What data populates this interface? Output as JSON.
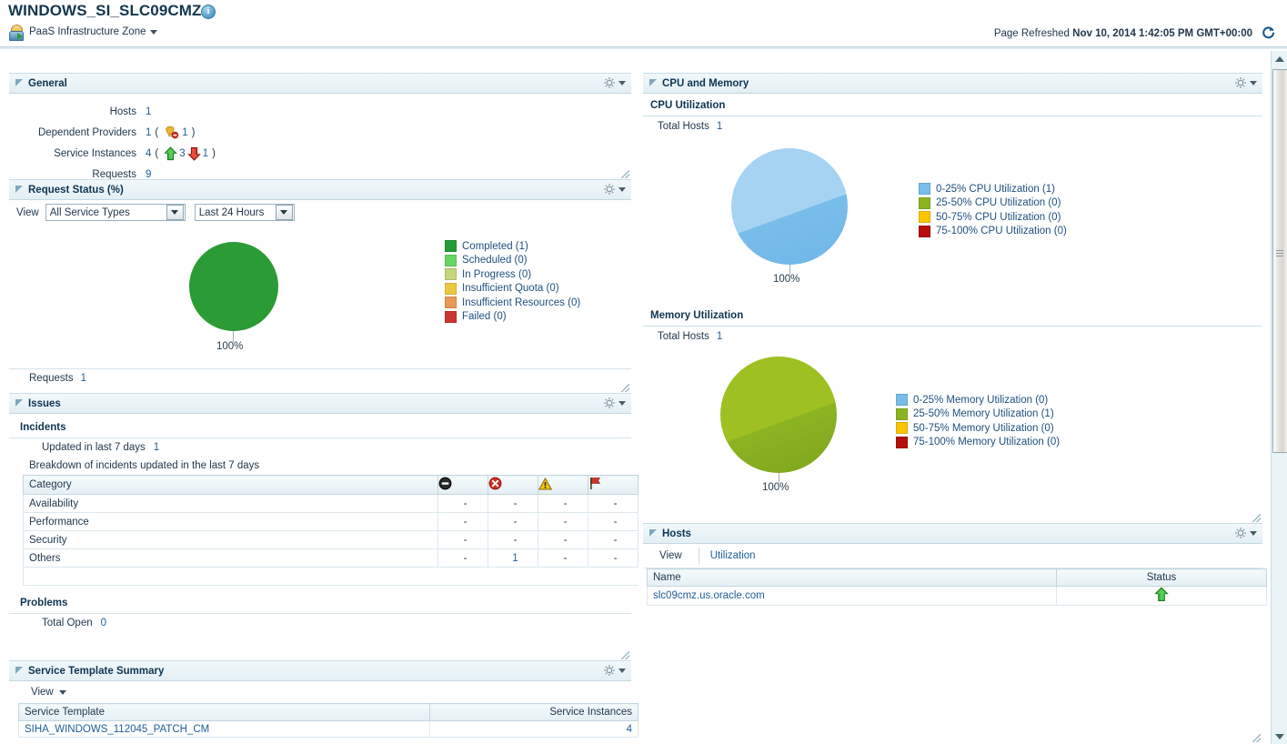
{
  "header": {
    "title": "WINDOWS_SI_SLC09CMZ",
    "info_icon": "info-icon",
    "zone_label": "PaaS Infrastructure Zone",
    "refresh_prefix": "Page Refreshed",
    "refresh_time": "Nov 10, 2014 1:42:05 PM GMT+00:00",
    "refresh_icon": "refresh-icon"
  },
  "general": {
    "panel_title": "General",
    "rows": [
      {
        "label": "Hosts",
        "value": "1"
      },
      {
        "label": "Dependent Providers",
        "value": "1",
        "paren_open": "(",
        "icon": "provider-error-icon",
        "icon_count": "1",
        "paren_close": ")"
      },
      {
        "label": "Service Instances",
        "value": "4",
        "paren_open": "(",
        "up_count": "3",
        "down_count": "1",
        "paren_close": ")"
      },
      {
        "label": "Requests",
        "value": "9"
      }
    ]
  },
  "request_status": {
    "panel_title": "Request Status (%)",
    "view_label": "View",
    "service_type_value": "All Service Types",
    "period_value": "Last 24 Hours",
    "pie_label": "100%",
    "footer_label": "Requests",
    "footer_value": "1",
    "legend": [
      {
        "label": "Completed (1)",
        "color": "#259b35"
      },
      {
        "label": "Scheduled (0)",
        "color": "#68d662"
      },
      {
        "label": "In Progress (0)",
        "color": "#c6d77b"
      },
      {
        "label": "Insufficient Quota (0)",
        "color": "#ebc840"
      },
      {
        "label": "Insufficient Resources (0)",
        "color": "#e89a55"
      },
      {
        "label": "Failed (0)",
        "color": "#cc3530"
      }
    ]
  },
  "issues": {
    "panel_title": "Issues",
    "incidents_title": "Incidents",
    "updated_label": "Updated in last 7 days",
    "updated_value": "1",
    "breakdown_note": "Breakdown of incidents updated in the last 7 days",
    "columns": [
      "Category",
      "fatal-icon",
      "critical-icon",
      "warning-icon",
      "flag-icon"
    ],
    "rows": [
      {
        "category": "Availability",
        "fatal": "-",
        "critical": "-",
        "warning": "-",
        "flag": "-"
      },
      {
        "category": "Performance",
        "fatal": "-",
        "critical": "-",
        "warning": "-",
        "flag": "-"
      },
      {
        "category": "Security",
        "fatal": "-",
        "critical": "-",
        "warning": "-",
        "flag": "-"
      },
      {
        "category": "Others",
        "fatal": "-",
        "critical": "1",
        "warning": "-",
        "flag": "-"
      }
    ],
    "problems_title": "Problems",
    "total_open_label": "Total Open",
    "total_open_value": "0"
  },
  "service_template_summary": {
    "panel_title": "Service Template Summary",
    "view_label": "View",
    "columns": [
      "Service Template",
      "Service Instances"
    ],
    "rows": [
      {
        "template": "SIHA_WINDOWS_112045_PATCH_CM",
        "instances": "4"
      }
    ]
  },
  "cpu_memory": {
    "panel_title": "CPU and Memory",
    "cpu_title": "CPU Utilization",
    "cpu_total_hosts_label": "Total Hosts",
    "cpu_total_hosts_value": "1",
    "cpu_pie_label": "100%",
    "cpu_legend": [
      {
        "label": "0-25% CPU Utilization (1)",
        "color": "#79bdea"
      },
      {
        "label": "25-50% CPU Utilization (0)",
        "color": "#8cb422"
      },
      {
        "label": "50-75% CPU Utilization (0)",
        "color": "#fbc400"
      },
      {
        "label": "75-100% CPU Utilization (0)",
        "color": "#b50d0d"
      }
    ],
    "mem_title": "Memory Utilization",
    "mem_total_hosts_label": "Total Hosts",
    "mem_total_hosts_value": "1",
    "mem_pie_label": "100%",
    "mem_legend": [
      {
        "label": "0-25% Memory Utilization (0)",
        "color": "#79bdea"
      },
      {
        "label": "25-50% Memory Utilization (1)",
        "color": "#8cb422"
      },
      {
        "label": "50-75% Memory Utilization (0)",
        "color": "#fbc400"
      },
      {
        "label": "75-100% Memory Utilization (0)",
        "color": "#b50d0d"
      }
    ]
  },
  "hosts": {
    "panel_title": "Hosts",
    "view_label": "View",
    "utilization_link": "Utilization",
    "columns": [
      "Name",
      "Status"
    ],
    "rows": [
      {
        "name": "slc09cmz.us.oracle.com",
        "status": "status-up-icon"
      }
    ]
  },
  "chart_data": [
    {
      "type": "pie",
      "title": "Request Status (%)",
      "categories": [
        "Completed",
        "Scheduled",
        "In Progress",
        "Insufficient Quota",
        "Insufficient Resources",
        "Failed"
      ],
      "values": [
        1,
        0,
        0,
        0,
        0,
        0
      ],
      "percent_labels": [
        "100%"
      ],
      "colors": [
        "#259b35",
        "#68d662",
        "#c6d77b",
        "#ebc840",
        "#e89a55",
        "#cc3530"
      ],
      "legend_position": "right"
    },
    {
      "type": "pie",
      "title": "CPU Utilization",
      "categories": [
        "0-25% CPU Utilization",
        "25-50% CPU Utilization",
        "50-75% CPU Utilization",
        "75-100% CPU Utilization"
      ],
      "values": [
        1,
        0,
        0,
        0
      ],
      "percent_labels": [
        "100%"
      ],
      "colors": [
        "#79bdea",
        "#8cb422",
        "#fbc400",
        "#b50d0d"
      ],
      "legend_position": "right"
    },
    {
      "type": "pie",
      "title": "Memory Utilization",
      "categories": [
        "0-25% Memory Utilization",
        "25-50% Memory Utilization",
        "50-75% Memory Utilization",
        "75-100% Memory Utilization"
      ],
      "values": [
        0,
        1,
        0,
        0
      ],
      "percent_labels": [
        "100%"
      ],
      "colors": [
        "#79bdea",
        "#8cb422",
        "#fbc400",
        "#b50d0d"
      ],
      "legend_position": "right"
    }
  ]
}
